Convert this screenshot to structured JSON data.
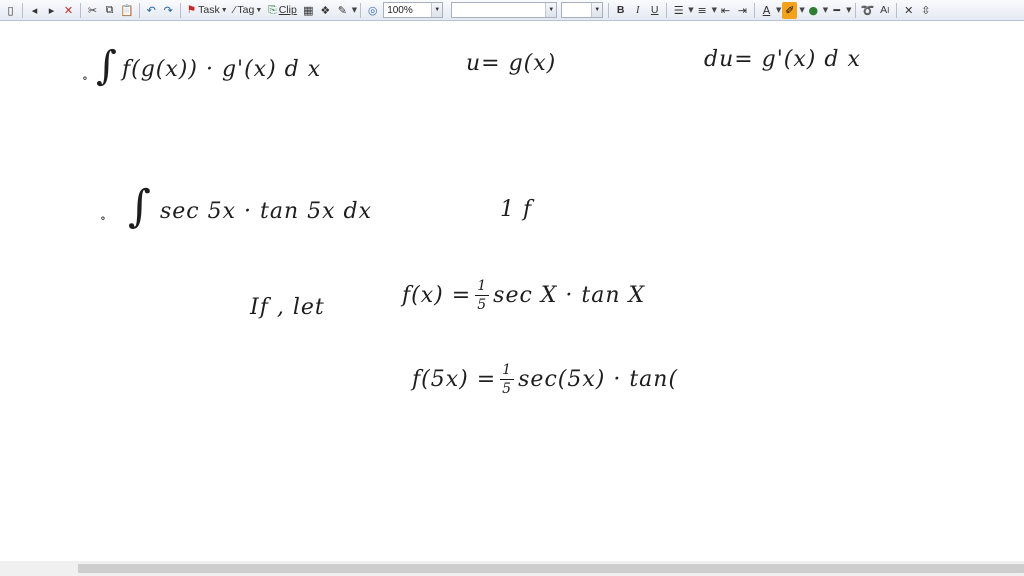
{
  "toolbar": {
    "task_label": "Task",
    "tag_label": "Tag",
    "clip_label": "Clip",
    "zoom_value": "100%",
    "font_name_value": "",
    "font_size_value": "",
    "bold_label": "B",
    "italic_label": "I",
    "underline_label": "U"
  },
  "note": {
    "line1": {
      "bullet": "∘",
      "integral": "∫",
      "expr": "f(g(x)) · g'(x) d x"
    },
    "sub_u": "u= g(x)",
    "sub_du": "du= g'(x) d x",
    "line2": {
      "bullet": "∘",
      "integral": "∫",
      "expr": "sec 5x · tan 5x dx"
    },
    "line2_aside": "1 f",
    "line3": {
      "lead": "If , let",
      "lhs": "f(x) =",
      "num": "1",
      "den": "5",
      "rhs": "sec X · tan X"
    },
    "line4": {
      "lhs": "f(5x) =",
      "num": "1",
      "den": "5",
      "rhs": "sec(5x) · tan("
    }
  }
}
